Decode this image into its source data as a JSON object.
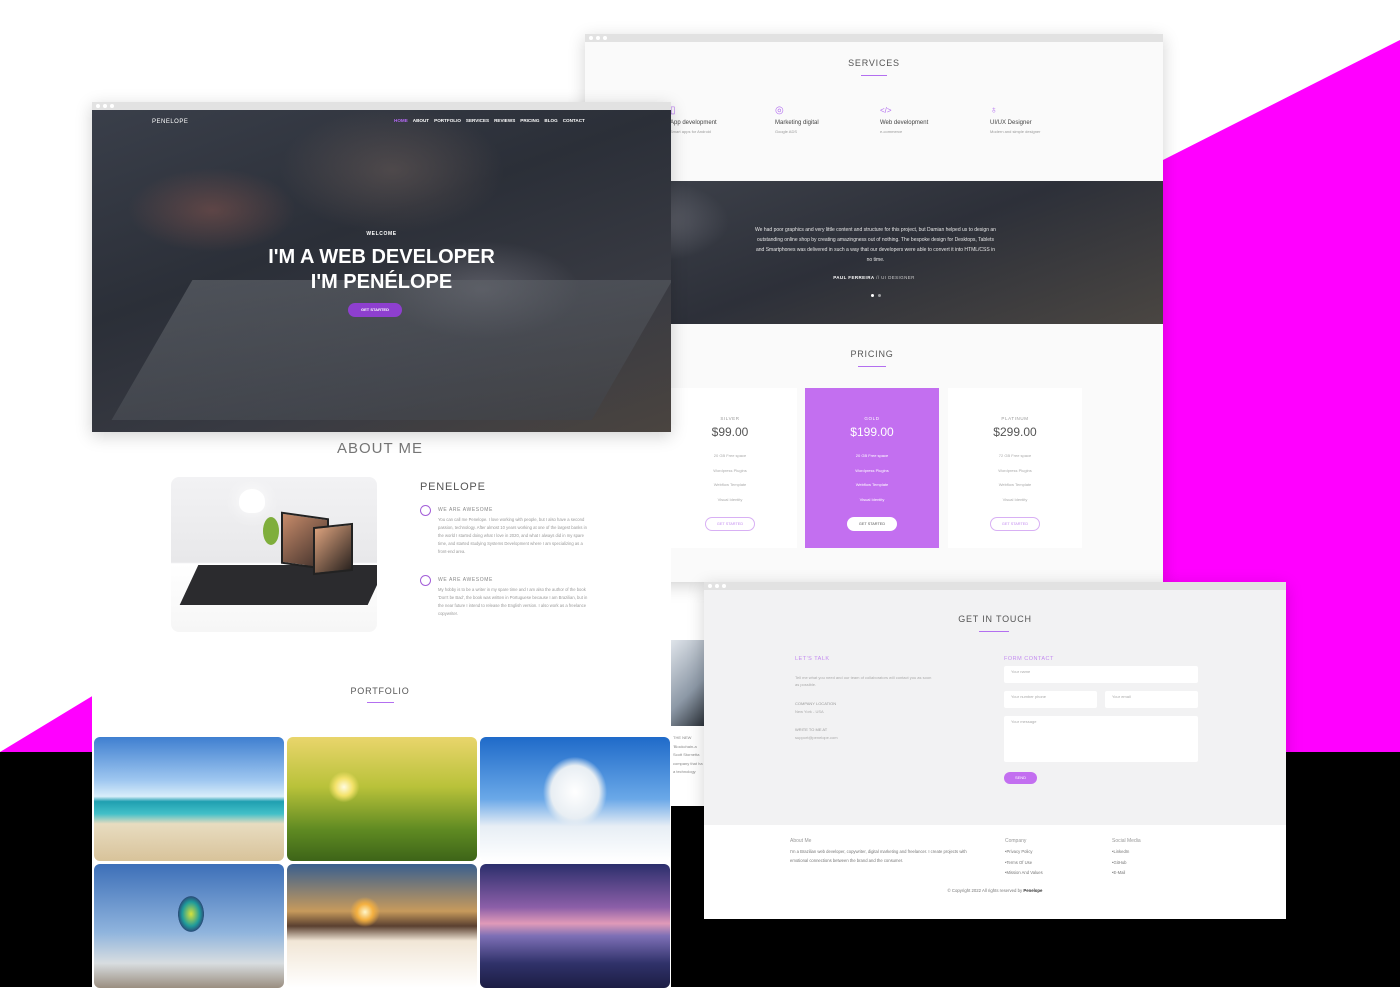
{
  "hero": {
    "logo": "PENELOPE",
    "nav": [
      "HOME",
      "ABOUT",
      "PORTFOLIO",
      "SERVICES",
      "REVIEWS",
      "PRICING",
      "BLOG",
      "CONTACT"
    ],
    "welcome": "WELCOME",
    "headline1": "I'M A WEB DEVELOPER",
    "headline2": "I'M PENÉLOPE",
    "cta": "GET STARTED"
  },
  "about": {
    "title": "ABOUT ME",
    "name": "PENELOPE",
    "blocks": [
      {
        "subtitle": "WE ARE AWESOME",
        "text": "You can call me Penelope. I love working with people, but I also have a second passion, technology. After almost 10 years working at one of the largest banks in the world I started doing what I love in 2020, and what I always did in my spare time, and started studying Systems Development where I am specializing as a front-end area."
      },
      {
        "subtitle": "WE ARE AWESOME",
        "text": "My hobby is to be a writer in my spare time and I am also the author of the book 'Don't be Bad', the book was written in Portuguese because I am Brazilian, but in the near future I intend to release the English version. I also work as a freelance copywriter."
      }
    ]
  },
  "portfolio": {
    "title": "PORTFOLIO",
    "tiles": [
      {
        "name": "beach-photo"
      },
      {
        "name": "wheat-field-photo"
      },
      {
        "name": "frosted-tree-photo"
      },
      {
        "name": "hot-air-balloon-photo"
      },
      {
        "name": "snowy-sunset-photo"
      },
      {
        "name": "lake-boat-photo"
      }
    ]
  },
  "services": {
    "title": "SERVICES",
    "items": [
      {
        "title": "App development",
        "sub": "Smart apps for Android",
        "icon": "phone-icon"
      },
      {
        "title": "Marketing digital",
        "sub": "Google ADS",
        "icon": "target-icon"
      },
      {
        "title": "Web development",
        "sub": "e-commerce",
        "icon": "code-icon"
      },
      {
        "title": "UI/UX Designer",
        "sub": "Modern and simple designer",
        "icon": "bulb-icon"
      }
    ]
  },
  "testimonial": {
    "quote": "We had poor graphics and very little content and structure for this project, but Damian helped us to design an outstanding online shop by creating amazingness out of nothing. The bespoke design for Desktops, Tablets and Smartphones was delivered in such a way that our developers were able to convert it into HTML/CSS in no time.",
    "author": "PAUL FERREIRA",
    "role": "// UI DESIGNER"
  },
  "pricing": {
    "title": "PRICING",
    "plans": [
      {
        "name": "SILVER",
        "price": "$99.00",
        "features": [
          "20 GB Free space",
          "Wordpress Plugins",
          "Webflow Template",
          "Visual Identity"
        ],
        "cta": "GET STARTED"
      },
      {
        "name": "GOLD",
        "price": "$199.00",
        "features": [
          "20 GB Free space",
          "Wordpress Plugins",
          "Webflow Template",
          "Visual Identity"
        ],
        "cta": "GET STARTED"
      },
      {
        "name": "PLATINUM",
        "price": "$299.00",
        "features": [
          "72 GB Free space",
          "Wordpress Plugins",
          "Webflow Template",
          "Visual Identity"
        ],
        "cta": "GET STARTED"
      }
    ]
  },
  "strip": {
    "label": "THE NEW",
    "text": "'Blockchain-a Scott Stornetta company that ha a technology"
  },
  "contact": {
    "title": "GET IN TOUCH",
    "lets_talk": "LET'S TALK",
    "intro": "Tell me what you need and our team of collaborators will contact you as soon as possible.",
    "location_label": "COMPANY LOCATION",
    "location": "New York - USA",
    "write_label": "WRITE TO ME AT",
    "email": "support@penelope.com",
    "form_label": "FORM CONTACT",
    "name_ph": "Your name",
    "phone_ph": "Your number phone",
    "email_ph": "Your email",
    "message_ph": "Your message",
    "send": "SEND"
  },
  "footer": {
    "about_title": "About Me",
    "about_text": "I'm a Brazilian web developer, copywriter, digital marketing and freelancer. I create projects with emotional connections between the brand and the consumer.",
    "company_title": "Company",
    "company_links": [
      "•Privacy Policy",
      "•Terms Of Use",
      "•Mission And Values"
    ],
    "social_title": "Social Media",
    "social_links": [
      "•LinkedIn",
      "•GitHub",
      "•E-Mail"
    ],
    "copyright": "© Copyright 2022 All rights reserved by ",
    "brand": "Penelope"
  },
  "colors": {
    "accent": "#c36ff0",
    "magenta_bg": "#ff00ff"
  }
}
